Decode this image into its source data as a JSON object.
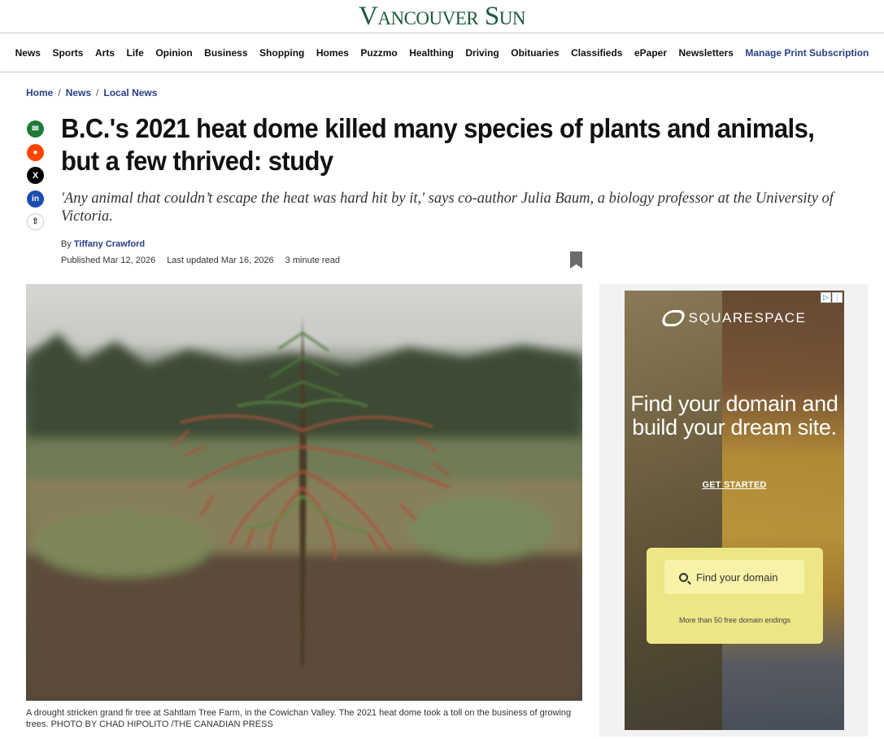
{
  "masthead": {
    "logo": "Vancouver Sun"
  },
  "nav": {
    "items": [
      "News",
      "Sports",
      "Arts",
      "Life",
      "Opinion",
      "Business",
      "Shopping",
      "Homes",
      "Puzzmo",
      "Healthing",
      "Driving",
      "Obituaries",
      "Classifieds",
      "ePaper",
      "Newsletters"
    ],
    "subscription": "Manage Print Subscription"
  },
  "breadcrumb": {
    "home": "Home",
    "news": "News",
    "local": "Local News",
    "sep": "/"
  },
  "share": {
    "email": "✉",
    "reddit": "●",
    "x": "X",
    "linkedin": "in",
    "more": "⇧"
  },
  "article": {
    "headline": "B.C.'s 2021 heat dome killed many species of plants and animals, but a few thrived: study",
    "dek": "'Any animal that couldn’t escape the heat was hard hit by it,' says co-author Julia Baum, a biology professor at the University of Victoria.",
    "by_prefix": "By",
    "author": "Tiffany Crawford",
    "published": "Published Mar 12, 2026",
    "updated": "Last updated Mar 16, 2026",
    "read_time": "3 minute read",
    "caption": "A drought stricken grand fir tree at Sahtlam Tree Farm, in the Cowichan Valley. The 2021 heat dome took a toll on the business of growing trees. PHOTO BY CHAD HIPOLITO /THE CANADIAN PRESS"
  },
  "ad": {
    "brand": "SQUARESPACE",
    "headline": "Find your domain and build your dream site.",
    "cta": "GET STARTED",
    "search_placeholder": "Find your domain",
    "small": "More than 50 free domain endings",
    "badge_play": "▷",
    "badge_info": "⋮"
  }
}
